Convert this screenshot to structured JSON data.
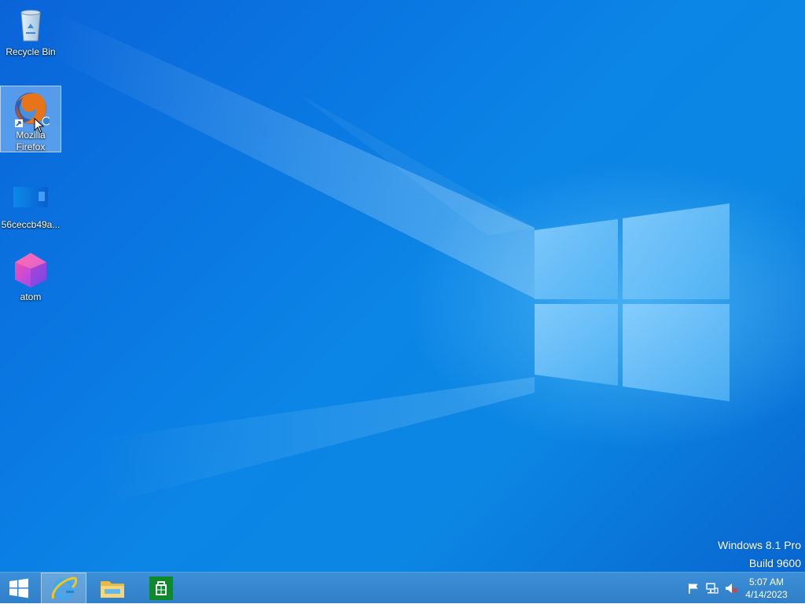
{
  "desktop": {
    "icons": [
      {
        "label": "Recycle Bin",
        "icon": "recycle-bin-icon"
      },
      {
        "label": "Mozilla Firefox",
        "icon": "firefox-icon"
      },
      {
        "label": "56ceccb49a...",
        "icon": "image-file-icon"
      },
      {
        "label": "atom",
        "icon": "atom-icon"
      }
    ],
    "watermark": {
      "line1": "Windows 8.1 Pro",
      "line2": "Build 9600"
    }
  },
  "taskbar": {
    "start": "start-icon",
    "pinned": [
      {
        "name": "internet-explorer",
        "icon": "internet-explorer-icon"
      },
      {
        "name": "file-explorer",
        "icon": "folder-icon"
      },
      {
        "name": "store",
        "icon": "store-icon"
      }
    ],
    "tray": {
      "icons": [
        "flag-icon",
        "network-icon",
        "volume-muted-icon"
      ],
      "time": "5:07 AM",
      "date": "4/14/2023"
    }
  },
  "colors": {
    "wallpaper": "#0b7fe0",
    "taskbar": "#3588d0"
  }
}
